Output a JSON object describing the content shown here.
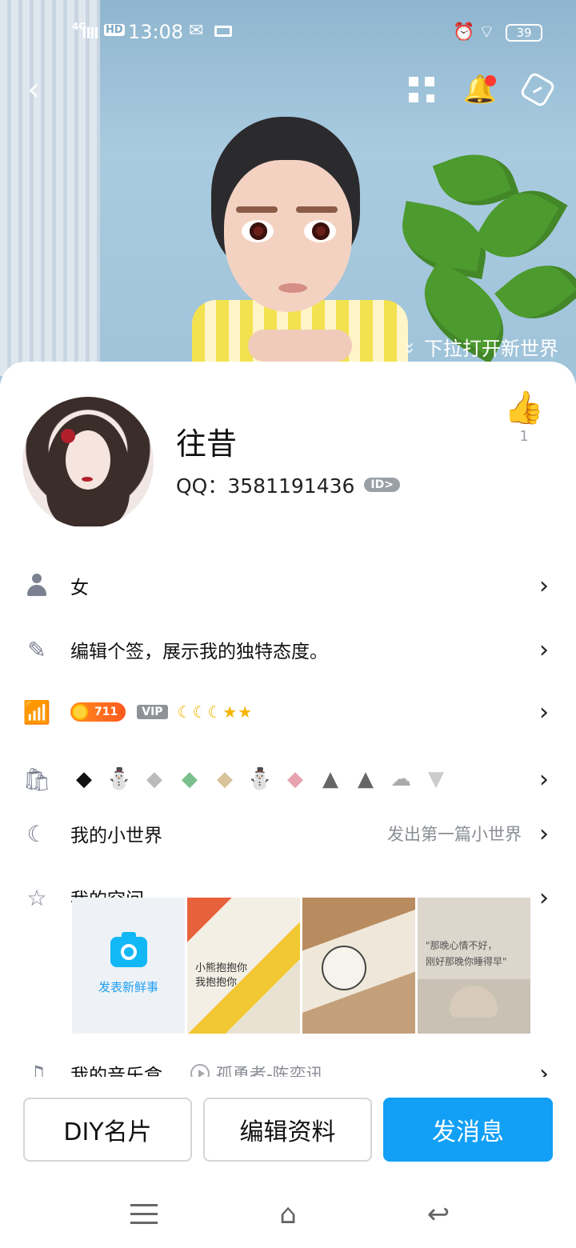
{
  "status_bar": {
    "network": "4G",
    "hd": "HD",
    "time": "13:08",
    "battery": "39"
  },
  "cover": {
    "pull_hint": "下拉打开新世界"
  },
  "profile": {
    "nickname": "往昔",
    "qq_label": "QQ：3581191436",
    "id_badge": "ID>",
    "likes": "1"
  },
  "rows": {
    "gender": "女",
    "signature": "编辑个签，展示我的独特态度。",
    "level_badge": "711",
    "vip": "VIP",
    "world_title": "我的小世界",
    "world_hint": "发出第一篇小世界",
    "space_title": "我的空间",
    "new_post": "发表新鲜事",
    "music_title": "我的音乐盒",
    "music_song": "孤勇者-陈奕讯"
  },
  "photos": {
    "p1_text": "小熊抱抱你\n我抱抱你",
    "p3_text": "\"那晚心情不好，\n刚好那晚你睡得早\""
  },
  "buttons": {
    "diy": "DIY名片",
    "edit": "编辑资料",
    "message": "发消息"
  },
  "colors": {
    "accent": "#12a0f7",
    "primary_button": "#12a0f7",
    "notification_dot": "#ff3b30"
  },
  "icons": {
    "back": "chevron-left-icon",
    "qr": "qr-code-icon",
    "bell": "bell-icon",
    "settings": "hexagon-settings-icon",
    "like": "thumbs-up-icon"
  }
}
